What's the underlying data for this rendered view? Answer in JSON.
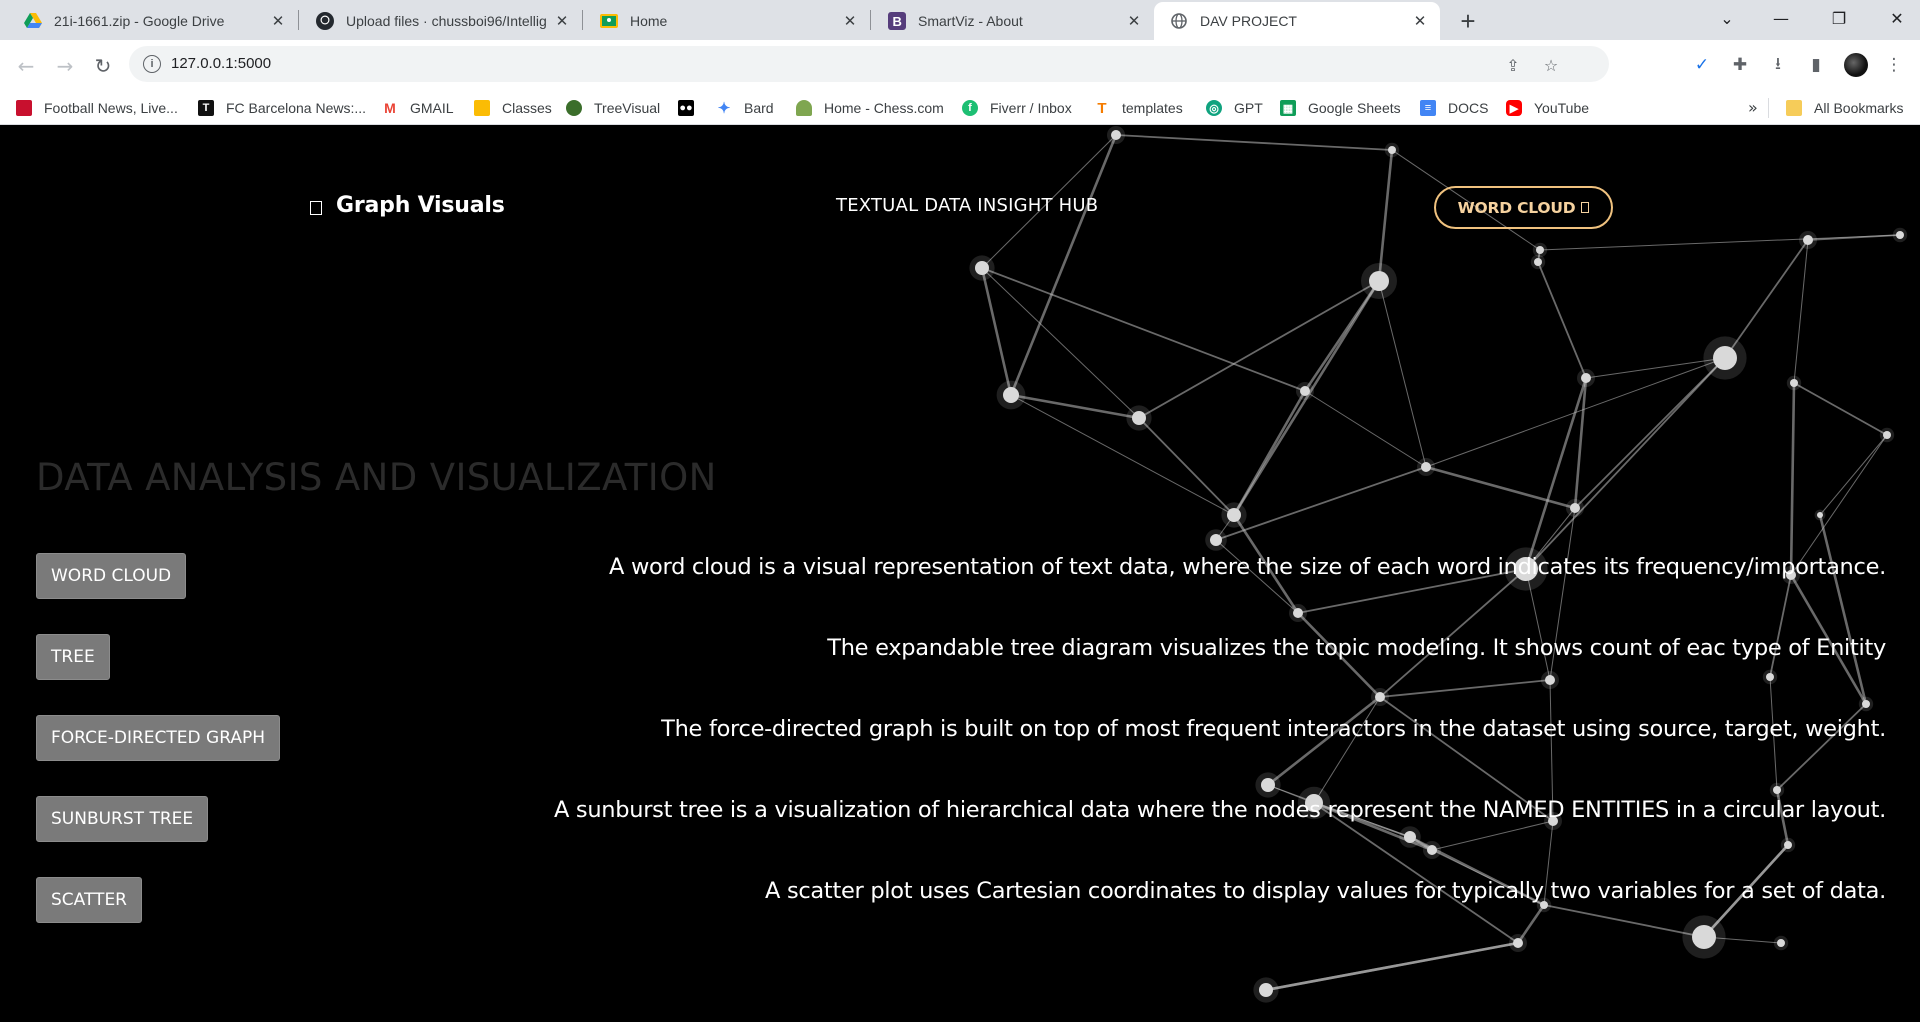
{
  "browser": {
    "tabs": [
      {
        "title": "21i-1661.zip - Google Drive",
        "icon": "google-drive-icon",
        "active": false
      },
      {
        "title": "Upload files · chussboi96/Intellig",
        "icon": "github-icon",
        "active": false
      },
      {
        "title": "Home",
        "icon": "classroom-icon",
        "active": false
      },
      {
        "title": "SmartViz - About",
        "icon": "bootstrap-icon",
        "active": false
      },
      {
        "title": "DAV PROJECT",
        "icon": "globe-icon",
        "active": true
      }
    ],
    "address": "127.0.0.1:5000",
    "bookmarks": [
      {
        "label": "Football News, Live...",
        "icon": "football-icon",
        "color": "#c8102e"
      },
      {
        "label": "FC Barcelona News:...",
        "icon": "barca-icon",
        "color": "#111111"
      },
      {
        "label": "GMAIL",
        "icon": "gmail-icon",
        "color": "#ea4335"
      },
      {
        "label": "Classes",
        "icon": "classroom-icon",
        "color": "#fbbc04"
      },
      {
        "label": "TreeVisual",
        "icon": "tree-icon",
        "color": "#3b6e2b"
      },
      {
        "label": "",
        "icon": "medium-icon",
        "color": "#000000"
      },
      {
        "label": "Bard",
        "icon": "bard-icon",
        "color": "#4285f4"
      },
      {
        "label": "Home - Chess.com",
        "icon": "chess-icon",
        "color": "#7fa650"
      },
      {
        "label": "Fiverr / Inbox",
        "icon": "fiverr-icon",
        "color": "#1dbf73"
      },
      {
        "label": "templates",
        "icon": "template-icon",
        "color": "#f57c00"
      },
      {
        "label": "GPT",
        "icon": "gpt-icon",
        "color": "#10a37f"
      },
      {
        "label": "Google Sheets",
        "icon": "sheets-icon",
        "color": "#0f9d58"
      },
      {
        "label": "DOCS",
        "icon": "docs-icon",
        "color": "#4285f4"
      },
      {
        "label": "YouTube",
        "icon": "youtube-icon",
        "color": "#ff0000"
      }
    ],
    "bookmarks_more": "»",
    "all_bookmarks": "All Bookmarks"
  },
  "page": {
    "brand": "Graph Visuals",
    "hub": "TEXTUAL DATA INSIGHT HUB",
    "header_button": "WORD CLOUD",
    "title": "DATA ANALYSIS AND VISUALIZATION",
    "items": [
      {
        "button": "WORD CLOUD",
        "description": "A word cloud is a visual representation of text data, where the size of each word indicates its frequency/importance."
      },
      {
        "button": "TREE",
        "description": "The expandable tree diagram visualizes the topic modeling. It shows count of eac type of Enitity"
      },
      {
        "button": "FORCE-DIRECTED GRAPH",
        "description": "The force-directed graph is built on top of most frequent interactors in the dataset using source, target, weight."
      },
      {
        "button": "SUNBURST TREE",
        "description": "A sunburst tree is a visualization of hierarchical data where the nodes represent the NAMED ENTITIES in a circular layout."
      },
      {
        "button": "SCATTER",
        "description": "A scatter plot uses Cartesian coordinates to display values for typically two variables for a set of data."
      }
    ]
  },
  "colors": {
    "accent": "#f0c27f",
    "button_bg": "#7a7a7a",
    "page_bg": "#000000"
  }
}
